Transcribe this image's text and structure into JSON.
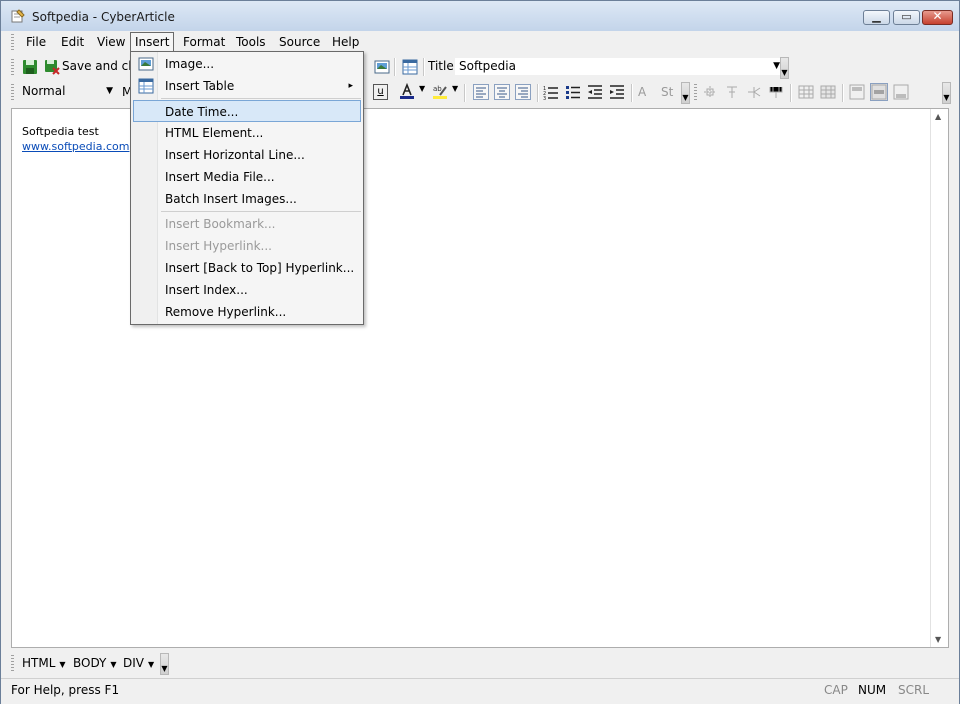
{
  "window": {
    "title": "Softpedia - CyberArticle"
  },
  "menubar": {
    "items": [
      "File",
      "Edit",
      "View",
      "Insert",
      "Format",
      "Tools",
      "Source",
      "Help"
    ],
    "active": "Insert"
  },
  "toolbar": {
    "save_close_label": "Save and close",
    "title_label": "Title",
    "title_value": "Softpedia"
  },
  "format_bar": {
    "style_value": "Normal",
    "font_partial": "M"
  },
  "insert_menu": {
    "items": [
      {
        "label": "Image...",
        "icon": "image-icon"
      },
      {
        "label": "Insert Table",
        "icon": "table-icon",
        "submenu": "▸"
      },
      {
        "label": "Date Time...",
        "highlighted": true
      },
      {
        "label": "HTML Element..."
      },
      {
        "label": "Insert Horizontal Line..."
      },
      {
        "label": "Insert Media File..."
      },
      {
        "label": "Batch Insert Images..."
      },
      {
        "label": "Insert Bookmark...",
        "disabled": true
      },
      {
        "label": "Insert Hyperlink...",
        "disabled": true
      },
      {
        "label": "Insert [Back to Top] Hyperlink..."
      },
      {
        "label": "Insert Index..."
      },
      {
        "label": "Remove Hyperlink..."
      }
    ]
  },
  "document": {
    "line1": "Softpedia test",
    "link": "www.softpedia.com"
  },
  "breadcrumb": {
    "items": [
      "HTML",
      "BODY",
      "DIV"
    ]
  },
  "statusbar": {
    "help": "For Help, press F1",
    "cap": "CAP",
    "num": "NUM",
    "scrl": "SCRL"
  },
  "colors": {
    "accent_highlight": "#d8e8f8",
    "link": "#0a4cb8",
    "save_green": "#2e8b2e"
  }
}
